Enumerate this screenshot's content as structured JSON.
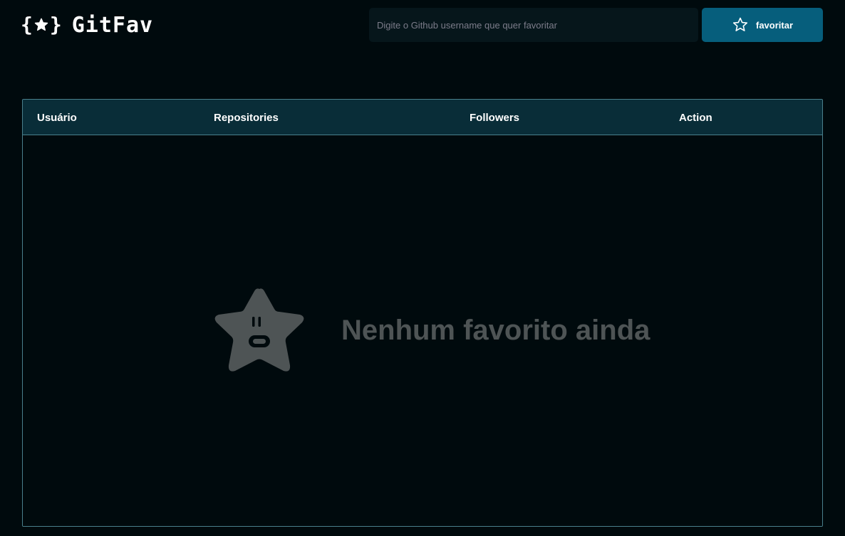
{
  "colors": {
    "background": "#000a0d",
    "accent": "#065e7c",
    "table_header": "#092d38",
    "border": "#4a808c",
    "muted_text": "#4e5455"
  },
  "header": {
    "logo_text": "GitFav",
    "logo_icon": "star-in-braces-icon",
    "search": {
      "placeholder": "Digite o Github username que quer favoritar",
      "value": ""
    },
    "favorite_button": {
      "label": "favoritar",
      "icon": "star-outline-icon"
    }
  },
  "table": {
    "columns": [
      "Usuário",
      "Repositories",
      "Followers",
      "Action"
    ],
    "rows": [],
    "empty_state": {
      "icon": "surprised-star-icon",
      "message": "Nenhum favorito ainda"
    }
  }
}
